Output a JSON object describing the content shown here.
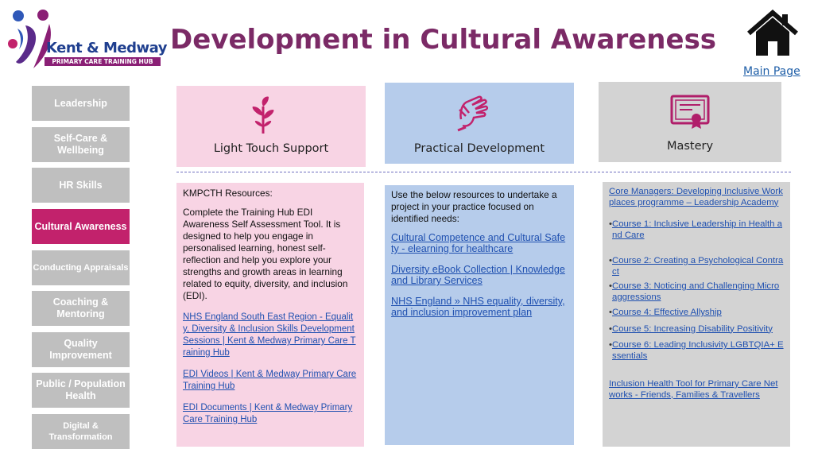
{
  "logo": {
    "name": "Kent & Medway",
    "sub": "PRIMARY CARE TRAINING HUB"
  },
  "page_title": "Development in Cultural Awareness",
  "nav": {
    "home_icon": "home-icon",
    "main_page": "Main Page"
  },
  "sidebar": {
    "items": [
      {
        "label": "Leadership"
      },
      {
        "label": "Self-Care & Wellbeing"
      },
      {
        "label": "HR Skills"
      },
      {
        "label": "Cultural Awareness"
      },
      {
        "label": "Conducting Appraisals"
      },
      {
        "label": "Coaching & Mentoring"
      },
      {
        "label": "Quality Improvement"
      },
      {
        "label": "Public / Population Health"
      },
      {
        "label": "Digital & Transformation"
      }
    ],
    "active_color": "#c2226c",
    "inactive_color": "#bfbfbf"
  },
  "columns": {
    "light": {
      "header": "Light Touch Support",
      "icon": "plant-icon",
      "bg": "#f8d4e4",
      "resources_title": "KMPCTH Resources:",
      "intro": "Complete the Training Hub EDI Awareness Self Assessment Tool. It is designed to help you engage in personalised learning, honest self-reflection and help you explore your strengths and growth areas in learning related to equity, diversity, and inclusion (EDI).",
      "links": [
        "NHS England South East Region - Equality, Diversity & Inclusion Skills Development Sessions   | Kent & Medway Primary Care Training Hub",
        "EDI Videos | Kent & Medway Primary Care Training Hub",
        "EDI Documents | Kent & Medway Primary Care Training Hub"
      ]
    },
    "practical": {
      "header": "Practical Development",
      "icon": "sign-language-icon",
      "bg": "#b6cceb",
      "intro": "Use  the below resources to undertake a project in your practice focused on identified needs:",
      "links": [
        "Cultural Competence and Cultural Safety - elearning for healthcare",
        "Diversity eBook Collection | Knowledge and Library Services",
        "NHS England » NHS equality, diversity, and inclusion improvement plan"
      ]
    },
    "mastery": {
      "header": "Mastery",
      "icon": "certificate-icon",
      "bg": "#d3d3d3",
      "programme": "Core Managers: Developing Inclusive Workplaces programme – Leadership Academy",
      "courses": [
        "Course 1: Inclusive Leadership in Health and Care",
        "Course 2: Creating a Psychological Contract",
        "Course 3: Noticing and Challenging Microaggressions",
        "Course 4: Effective Allyship",
        "Course 5: Increasing Disability Positivity",
        "Course 6: Leading Inclusivity LGBTQIA+ Essentials"
      ],
      "tool": "Inclusion Health Tool for Primary Care Networks - Friends, Families & Travellers"
    }
  },
  "colors": {
    "title": "#7b2a66",
    "accent_magenta": "#c2226c",
    "link": "#1f50b0"
  }
}
